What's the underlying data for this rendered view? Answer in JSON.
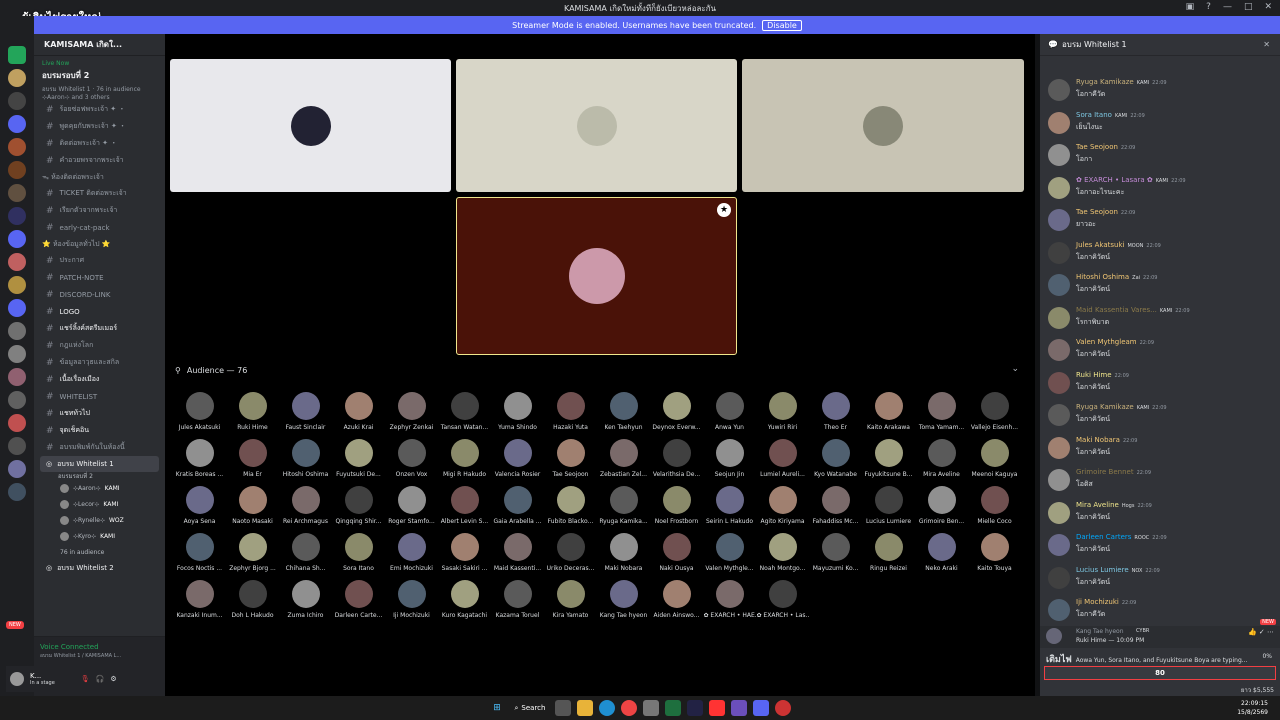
{
  "window": {
    "title": "KAMISAMA เกิดใหม่ทั้งทีก็ยังเบียวหล่อละกัน",
    "overlay_title": "ผู้เดินไฟรายใหญ่"
  },
  "streamer_banner": {
    "text": "Streamer Mode is enabled. Usernames have been truncated.",
    "button": "Disable"
  },
  "server": {
    "name": "KAMISAMA เกิดใ...",
    "live_label": "Live Now",
    "stage_title": "อบรมรอบที่ 2",
    "stage_meta": "อบรม Whitelist 1 · 76 in audience",
    "stage_people": "⊹Aaron⊹ and 3 others"
  },
  "channels": [
    {
      "label": "ร้อยซ่อฟพระเจ้า ✦ ・"
    },
    {
      "label": "พูดคุยกับพระเจ้า ✦ ・"
    },
    {
      "label": "ติดต่อพระเจ้า ✦ ・"
    },
    {
      "label": "คำอวยพรจากพระเจ้า"
    }
  ],
  "category1": "ᯓ ห้องติดต่อพระเจ้า",
  "channels2": [
    {
      "label": "TICKET ติดต่อพระเจ้า"
    },
    {
      "label": "เรียกตัวจากพระเจ้า"
    },
    {
      "label": "early-cat-pack"
    }
  ],
  "category2": "⭐ ห้องข้อมูลทั่วไป ⭐",
  "channels3": [
    {
      "label": "ประกาศ"
    },
    {
      "label": "PATCH-NOTE"
    },
    {
      "label": "DISCORD-LINK"
    },
    {
      "label": "LOGO"
    },
    {
      "label": "แชร์ลิ้งค์สตรีมเมอร์"
    },
    {
      "label": "กฎแห่งโลก"
    },
    {
      "label": "ข้อมูลอาวุธและสกิล"
    },
    {
      "label": "เนื้อเรื่องเมือง"
    },
    {
      "label": "WHITELIST"
    },
    {
      "label": "แชทท้วไป"
    },
    {
      "label": "จุดเช็คอิน"
    },
    {
      "label": "อบรมพิมพ์กันในห้องนี้"
    }
  ],
  "voice_channels": [
    {
      "label": "อบรม Whitelist 1",
      "sub": "อบรมรอบที่ 2"
    },
    {
      "label": "อบรม Whitelist 2",
      "sub": ""
    }
  ],
  "speakers": [
    {
      "name": "⊹Aaron⊹",
      "tag": "KAMI"
    },
    {
      "name": "⊹Lecor⊹",
      "tag": "KAMI"
    },
    {
      "name": "⊹Rynelle⊹",
      "tag": "WOZ"
    },
    {
      "name": "⊹Kyro⊹",
      "tag": "KAMI"
    }
  ],
  "in_audience": "76 in audience",
  "voice": {
    "status": "Voice Connected",
    "sub": "อบรม Whitelist 1 / KAMISAMA L...",
    "user": "K...",
    "user_status": "In a stage",
    "new_badge": "NEW"
  },
  "audience": {
    "header": "Audience — 76",
    "members": [
      "Jules Akatsuki",
      "Ruki Hime",
      "Faust Sinclair",
      "Azuki Krai",
      "Zephyr Zenkai",
      "Tansan Watan...",
      "Yuma Shindo",
      "Hazaki Yuta",
      "Ken Taehyun",
      "Deynox Everw...",
      "Anwa Yun",
      "Yuwiri Riri",
      "Theo Er",
      "Kaito Arakawa",
      "Toma Yamam...",
      "Vallejo Eisenh...",
      "Kratis Boreas ...",
      "Mia Er",
      "Hitoshi Oshima",
      "Fuyutsuki De...",
      "Onzen Vox",
      "Migi R Hakudo",
      "Valencia Rosier",
      "Tae Seojoon",
      "Zebastian Zel...",
      "Velarithsia De...",
      "Seojun Jin",
      "Lumiel Aureli...",
      "Kyo Watanabe",
      "Fuyukitsune B...",
      "Mira Aveline",
      "Meenoi Kaguya",
      "Aoya Sena",
      "Naoto Masaki",
      "Rei Archmagus",
      "Qingqing Shir...",
      "Roger Stamfo...",
      "Albert Levin S...",
      "Gaia Arabella ...",
      "Fubito Blacko...",
      "Ryuga Kamika...",
      "Noel Frostborn",
      "Seirin L Hakudo",
      "Agito Kiriyama",
      "Fahaddiss Mc...",
      "Lucius Lumiere",
      "Grimoire Ben...",
      "Mielle Coco",
      "Focos Noctis ...",
      "Zephyr Bjorg ...",
      "Chihana Sh...",
      "Sora Itano",
      "Emi Mochizuki",
      "Sasaki Sakiri ...",
      "Maid Kassenti...",
      "Uriko Deceras...",
      "Maki Nobara",
      "Naki Ousya",
      "Valen Mythgle...",
      "Noah Montgo...",
      "Mayuzumi Ko...",
      "Ringu Reizei",
      "Neko Araki",
      "Kaito Touya",
      "Kanzaki Inum...",
      "Doh L Hakudo",
      "Zuma Ichiro",
      "Darleen Carte...",
      "Iji Mochizuki",
      "Kuro Kagatachi",
      "Kazama Toruel",
      "Kira Yamato",
      "Kang Tae hyeon",
      "Aiden Ainswo...",
      "✿ EXARCH • HAE...",
      "✿ EXARCH • Las..."
    ]
  },
  "chat": {
    "header": "อบรม Whitelist 1",
    "messages": [
      {
        "author": "Ryuga Kamikaze",
        "color": "#c9b27c",
        "tag": "KAMI",
        "time": "22:09",
        "text": "โอกาคีวัด"
      },
      {
        "author": "Sora Itano",
        "color": "#7ec8e3",
        "tag": "KAMI",
        "time": "22:09",
        "text": "เย็นไงนะ"
      },
      {
        "author": "Tae Seojoon",
        "color": "#f0c674",
        "tag": "",
        "time": "22:09",
        "text": "โอกา"
      },
      {
        "author": "✿ EXARCH • Lasara ✿",
        "color": "#c38bd6",
        "tag": "KAMI",
        "time": "22:09",
        "text": "โอกาอะไรนะคะ"
      },
      {
        "author": "Tae Seojoon",
        "color": "#f0c674",
        "tag": "",
        "time": "22:09",
        "text": "ยาวอะ"
      },
      {
        "author": "Jules Akatsuki",
        "color": "#f0c674",
        "tag": "MOON",
        "time": "22:09",
        "text": "โอกาคิวัตน์"
      },
      {
        "author": "Hitoshi Oshima",
        "color": "#f0c674",
        "tag": "Zai",
        "time": "22:09",
        "text": "โอกาคิวัตน์"
      },
      {
        "author": "Maid Kassentia Vares...",
        "color": "#8b7a4a",
        "tag": "KAMI",
        "time": "22:09",
        "text": "โรกาพิบาต"
      },
      {
        "author": "Valen Mythgleam",
        "color": "#f0c674",
        "tag": "",
        "time": "22:09",
        "text": "โอกาคิวัตน์"
      },
      {
        "author": "Ruki Hime",
        "color": "#f0e68c",
        "tag": "",
        "time": "22:09",
        "text": "โอกาคิวัตน์"
      },
      {
        "author": "Ryuga Kamikaze",
        "color": "#c9b27c",
        "tag": "KAMI",
        "time": "22:09",
        "text": "โอกาคิวัตน์"
      },
      {
        "author": "Maki Nobara",
        "color": "#f0c674",
        "tag": "",
        "time": "22:09",
        "text": "โอกาคิวัตน์"
      },
      {
        "author": "Grimoire Bennet",
        "color": "#8b7a4a",
        "tag": "",
        "time": "22:09",
        "text": "โอติส"
      },
      {
        "author": "Mira Aveline",
        "color": "#f0e68c",
        "tag": "Hogs",
        "time": "22:09",
        "text": "โอกาคิวัตน์"
      },
      {
        "author": "Darleen Carters",
        "color": "#00a8fc",
        "tag": "ROOC",
        "time": "22:09",
        "text": "โอกาคิวัตน์"
      },
      {
        "author": "Lucius Lumiere",
        "color": "#7ec8e3",
        "tag": "NOX",
        "time": "22:09",
        "text": "โอกาคิวัตน์"
      },
      {
        "author": "Iji Mochizuki",
        "color": "#f0c674",
        "tag": "",
        "time": "22:09",
        "text": "โอกาคีวัด"
      }
    ],
    "reply_author": "Kang Tae hyeon",
    "reply_tag": "CYBR",
    "reply_text": "Ruki Hime — 10:09 PM",
    "typing": "Aowa Yun, Sora Itano, and Fuyukitsune Boya are typing...",
    "input_value": "80",
    "new_label": "NEW",
    "overlay_label": "เติมไฟ",
    "percent": "0%",
    "coins": "ยาว $5,555"
  },
  "taskbar": {
    "search": "Search",
    "time": "22:09:15",
    "date": "15/8/2569"
  }
}
